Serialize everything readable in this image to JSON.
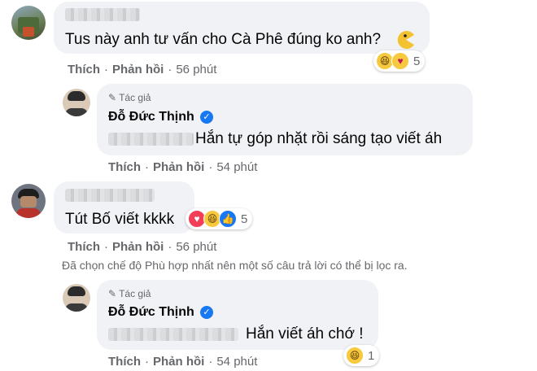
{
  "comments": [
    {
      "id": "c1",
      "text": "Tus này anh tư vấn cho Cà Phê đúng ko anh?",
      "actions": {
        "like": "Thích",
        "reply": "Phản hồi",
        "time": "56 phút"
      },
      "reactions": {
        "icons": [
          "haha-icon",
          "care-icon"
        ],
        "count": "5"
      }
    },
    {
      "id": "r1",
      "author_tag": "Tác giả",
      "author_name": "Đỗ Đức Thịnh",
      "text": "Hắn tự góp nhặt rồi sáng tạo viết áh",
      "actions": {
        "like": "Thích",
        "reply": "Phản hồi",
        "time": "54 phút"
      }
    },
    {
      "id": "c2",
      "text": "Tút Bố viết kkkk",
      "actions": {
        "like": "Thích",
        "reply": "Phản hồi",
        "time": "56 phút"
      },
      "reactions": {
        "icons": [
          "love-icon",
          "haha-icon",
          "like-icon"
        ],
        "count": "5"
      }
    },
    {
      "id": "r2",
      "author_tag": "Tác giả",
      "author_name": "Đỗ Đức Thịnh",
      "text": "Hắn viết áh chớ !",
      "actions": {
        "like": "Thích",
        "reply": "Phản hồi",
        "time": "54 phút"
      },
      "reactions": {
        "icons": [
          "haha-icon"
        ],
        "count": "1"
      }
    }
  ],
  "filter_notice": "Đã chọn chế độ Phù hợp nhất nên một số câu trả lời có thể bị lọc ra.",
  "colors": {
    "bubble": "#f0f2f5",
    "meta": "#65676b",
    "verified": "#1877f2"
  }
}
